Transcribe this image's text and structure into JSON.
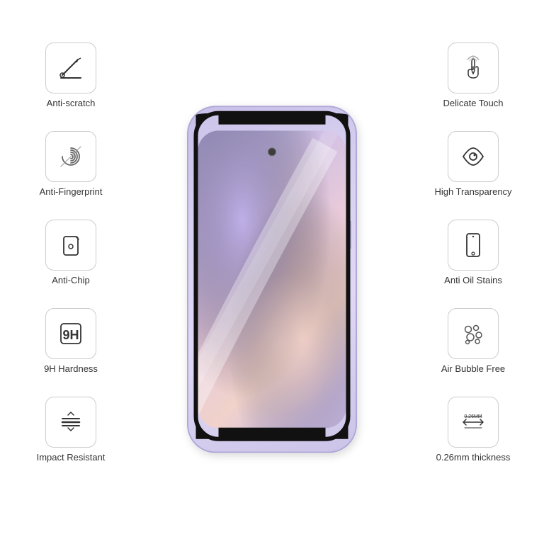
{
  "features_left": [
    {
      "id": "anti-scratch",
      "label": "Anti-scratch",
      "icon": "scratch"
    },
    {
      "id": "anti-fingerprint",
      "label": "Anti-Fingerprint",
      "icon": "fingerprint"
    },
    {
      "id": "anti-chip",
      "label": "Anti-Chip",
      "icon": "chip"
    },
    {
      "id": "9h-hardness",
      "label": "9H Hardness",
      "icon": "9h"
    },
    {
      "id": "impact-resistant",
      "label": "Impact Resistant",
      "icon": "impact"
    }
  ],
  "features_right": [
    {
      "id": "delicate-touch",
      "label": "Delicate Touch",
      "icon": "touch"
    },
    {
      "id": "high-transparency",
      "label": "High Transparency",
      "icon": "eye"
    },
    {
      "id": "anti-oil",
      "label": "Anti Oil Stains",
      "icon": "phone-corner"
    },
    {
      "id": "air-bubble",
      "label": "Air Bubble Free",
      "icon": "bubbles"
    },
    {
      "id": "thickness",
      "label": "0.26mm thickness",
      "icon": "thickness"
    }
  ]
}
